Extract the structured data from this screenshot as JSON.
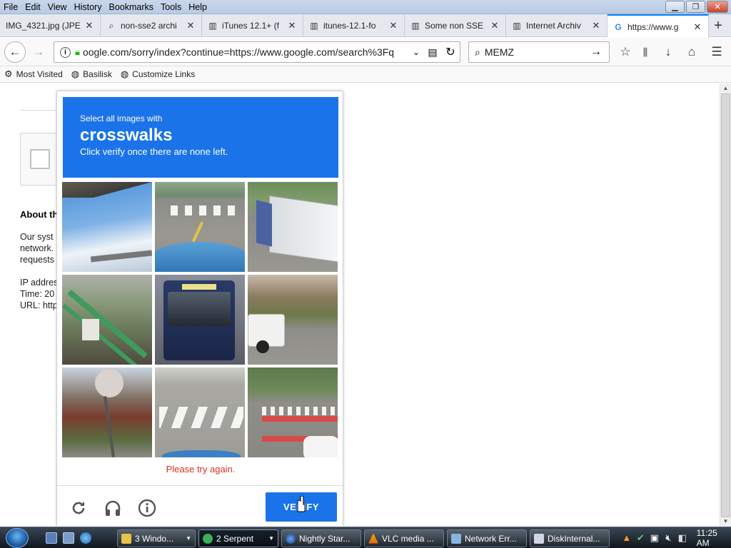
{
  "menu": [
    "File",
    "Edit",
    "View",
    "History",
    "Bookmarks",
    "Tools",
    "Help"
  ],
  "tabs": [
    {
      "title": "IMG_4321.jpg (JPE",
      "icon": "image-icon"
    },
    {
      "title": "non-sse2 archi",
      "icon": "search-icon"
    },
    {
      "title": "iTunes 12.1+ (f",
      "icon": "archive-icon"
    },
    {
      "title": "itunes-12.1-fo",
      "icon": "archive-icon"
    },
    {
      "title": "Some non SSE",
      "icon": "archive-icon"
    },
    {
      "title": "Internet Archiv",
      "icon": "archive-icon"
    },
    {
      "title": "https://www.g",
      "icon": "google-icon",
      "active": true
    }
  ],
  "url": "oogle.com/sorry/index?continue=https://www.google.com/search%3Fq",
  "search": {
    "value": "MEMZ"
  },
  "bookmarks": [
    "Most Visited",
    "Basilisk",
    "Customize Links"
  ],
  "background_page": {
    "about": "About th",
    "lines": [
      "Our syst",
      "network.",
      "requests",
      "IP addres",
      "Time: 20",
      "URL: http"
    ]
  },
  "challenge": {
    "select_text": "Select all images with",
    "object": "crosswalks",
    "hint": "Click verify once there are none left.",
    "error": "Please try again.",
    "verify_label": "VERIFY",
    "tiles": [
      "Blue sky with overpass edge",
      "Crosswalk seen from car hood",
      "Parked white trucks",
      "Stairway with green railings",
      "Front of a blue city bus",
      "Road with white truck",
      "Stop sign and houses",
      "Zebra crosswalk on street",
      "Red and white crosswalk intersection"
    ]
  },
  "taskbar": {
    "tasks": [
      {
        "label": "3 Windo...",
        "icon": "folder-icon"
      },
      {
        "label": "2 Serpent",
        "icon": "serpent-icon",
        "active": true
      },
      {
        "label": "Nightly Star...",
        "icon": "globe-icon"
      },
      {
        "label": "VLC media ...",
        "icon": "vlc-icon"
      },
      {
        "label": "Network Err...",
        "icon": "network-icon"
      },
      {
        "label": "DiskInternal...",
        "icon": "disk-icon"
      }
    ],
    "clock": "11:25 AM"
  },
  "colors": {
    "accent": "#1a73e8",
    "error": "#d93025",
    "tab_active": "#0a84ff"
  }
}
